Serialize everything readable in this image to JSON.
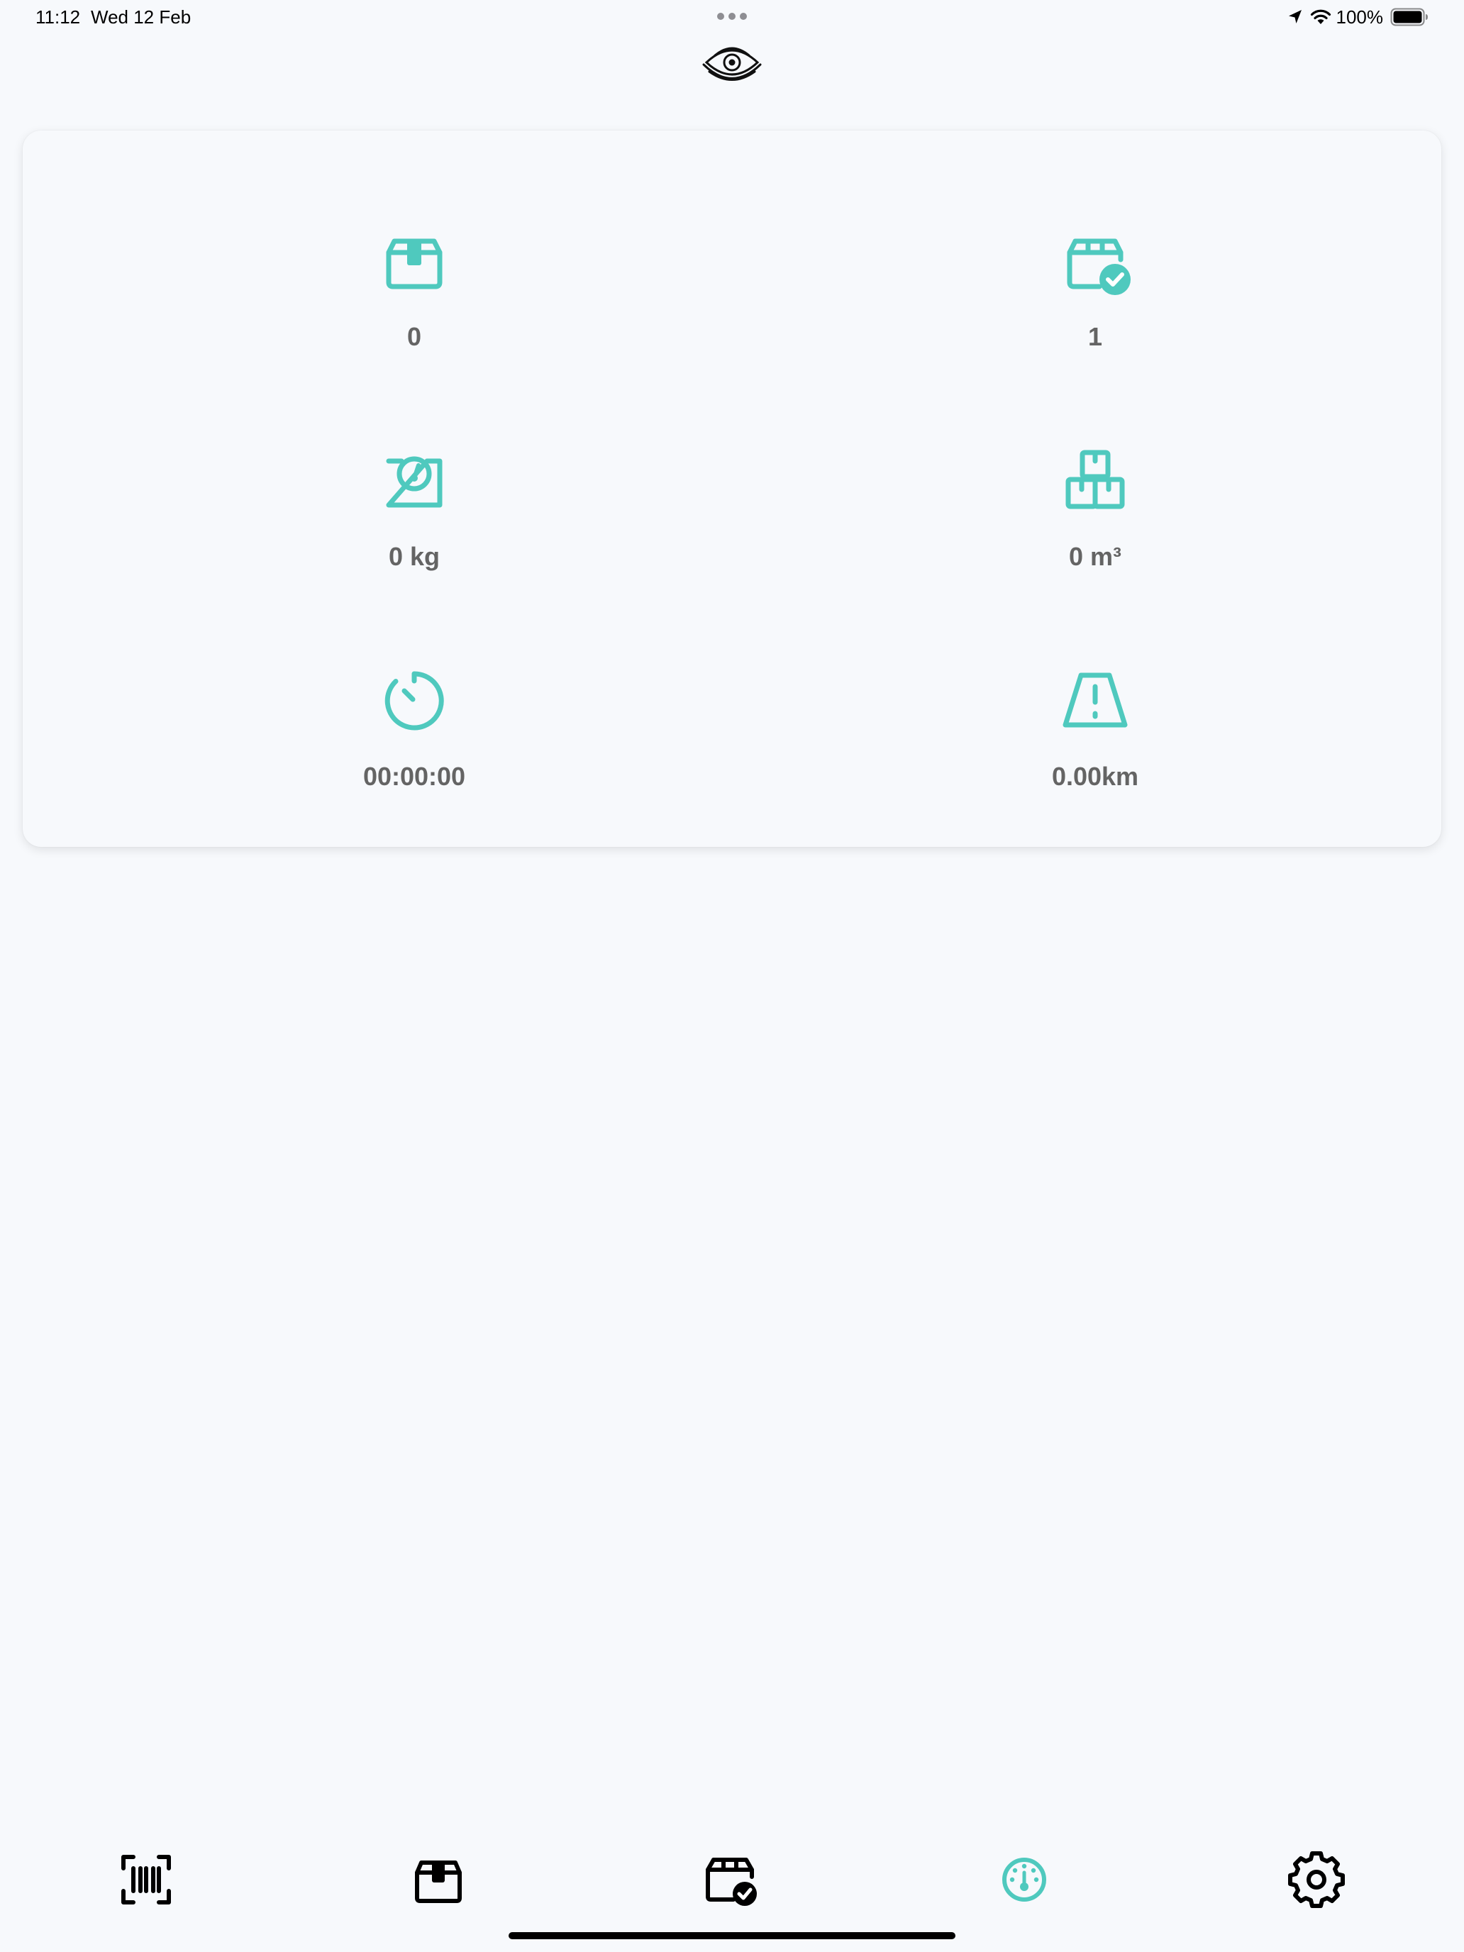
{
  "status_bar": {
    "time": "11:12",
    "date": "Wed 12 Feb",
    "battery_percent": "100%",
    "icons": [
      "location-arrow-icon",
      "wifi-icon",
      "battery-icon"
    ]
  },
  "header": {
    "logo_icon": "eye-logo-icon"
  },
  "stats": {
    "packages_pending": {
      "icon": "package-icon",
      "value": "0"
    },
    "packages_delivered": {
      "icon": "package-check-icon",
      "value": "1"
    },
    "weight": {
      "icon": "scale-icon",
      "value": "0 kg"
    },
    "volume": {
      "icon": "boxes-icon",
      "value": "0 m³"
    },
    "duration": {
      "icon": "timer-icon",
      "value": "00:00:00"
    },
    "distance": {
      "icon": "road-icon",
      "value": "0.00km"
    }
  },
  "tab_bar": {
    "tabs": [
      {
        "id": "scan",
        "icon": "barcode-scan-icon",
        "active": false
      },
      {
        "id": "packages",
        "icon": "package-icon",
        "active": false
      },
      {
        "id": "delivered",
        "icon": "package-check-icon",
        "active": false
      },
      {
        "id": "dashboard",
        "icon": "gauge-icon",
        "active": true
      },
      {
        "id": "settings",
        "icon": "gear-icon",
        "active": false
      }
    ]
  },
  "colors": {
    "accent": "#4fc9be",
    "background": "#f7f9fc",
    "value_text": "#646464",
    "tab_inactive": "#000000"
  }
}
